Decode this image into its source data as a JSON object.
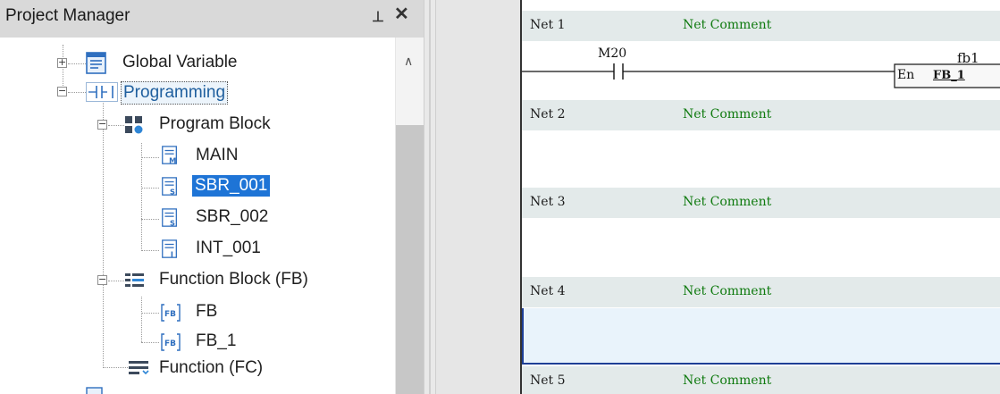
{
  "project_manager": {
    "title": "Project Manager",
    "pin_icon": "pin-icon",
    "close_icon": "close-icon",
    "tree": {
      "global_variable": "Global Variable",
      "programming": "Programming",
      "program_block": "Program Block",
      "main": "MAIN",
      "sbr_001": "SBR_001",
      "sbr_002": "SBR_002",
      "int_001": "INT_001",
      "function_block": "Function Block (FB)",
      "fb": "FB",
      "fb_1": "FB_1",
      "function": "Function (FC)"
    },
    "icon_letters": {
      "main": "M",
      "sbr": "S",
      "int": "I",
      "fb": "FB"
    }
  },
  "editor": {
    "nets": [
      {
        "label": "Net 1",
        "comment": "Net Comment"
      },
      {
        "label": "Net 2",
        "comment": "Net Comment"
      },
      {
        "label": "Net 3",
        "comment": "Net Comment"
      },
      {
        "label": "Net 4",
        "comment": "Net Comment"
      },
      {
        "label": "Net 5",
        "comment": "Net Comment"
      }
    ],
    "contact_label": "M20",
    "fb_instance": "fb1",
    "fb_pin": "En",
    "fb_type": "FB_1"
  },
  "colors": {
    "selection": "#1e74d6",
    "comment_green": "#0f7a0f",
    "net_header": "#e3eaea",
    "selected_net": "#e9f3fb",
    "icon_blue": "#2f6fbf"
  }
}
